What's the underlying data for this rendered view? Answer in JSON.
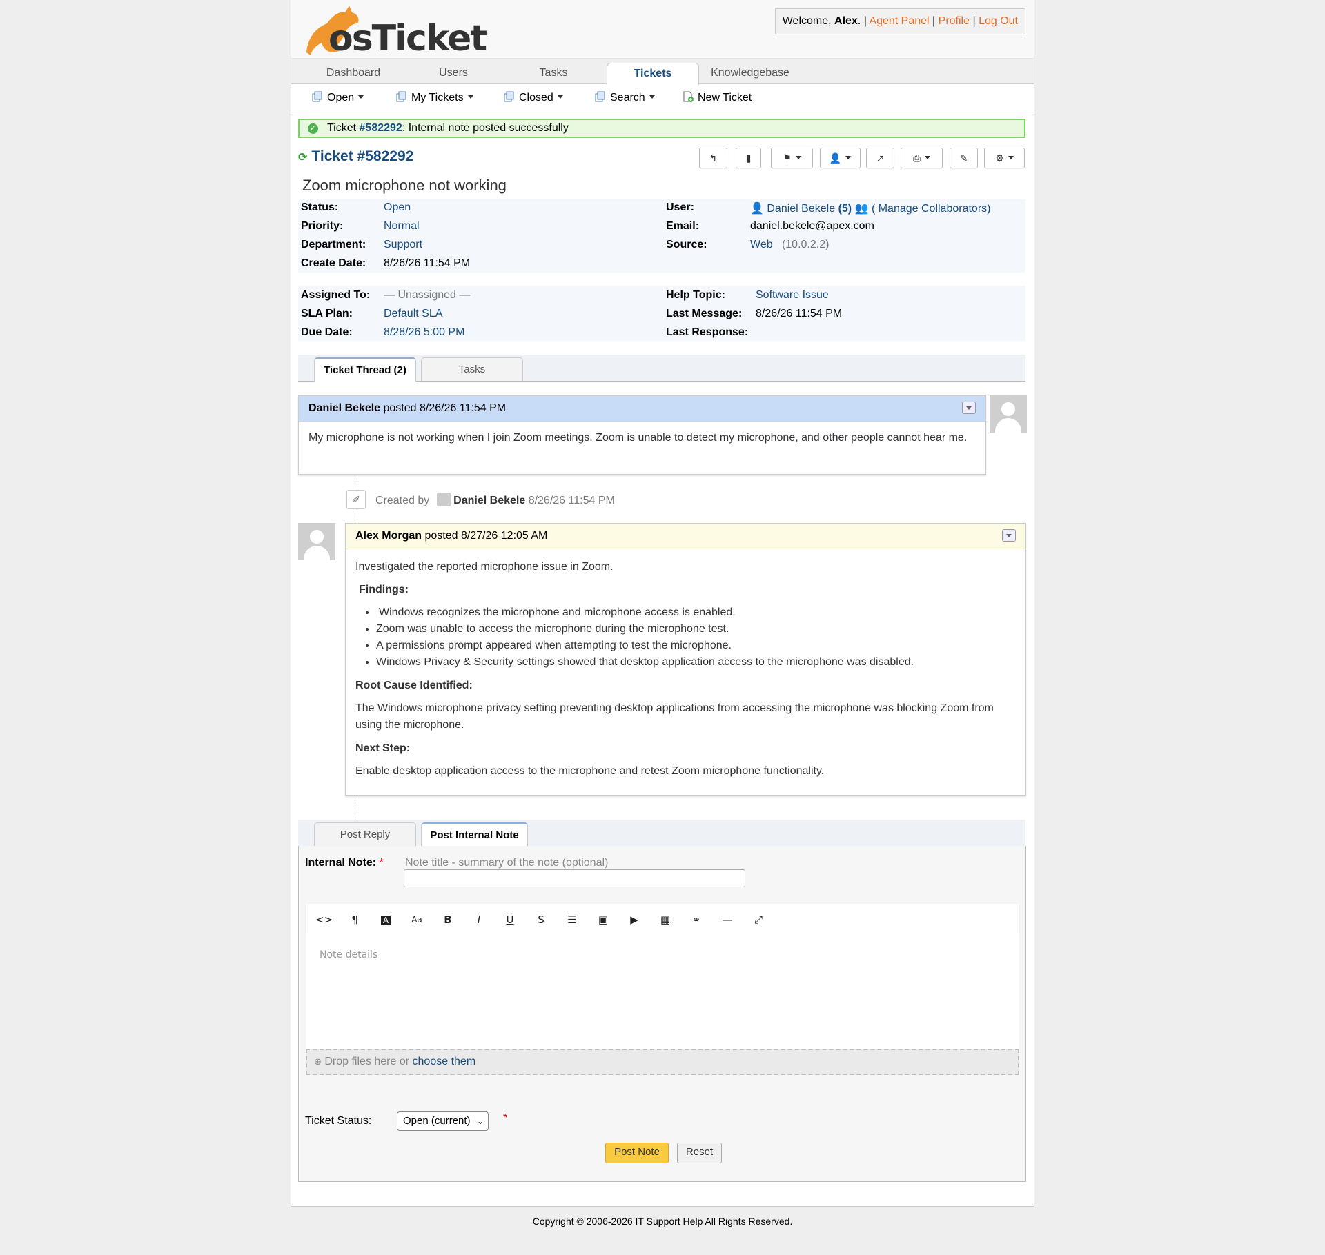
{
  "header": {
    "logo_text": "osTicket",
    "welcome_prefix": "Welcome, ",
    "user_name": "Alex",
    "welcome_suffix": ". | ",
    "agent_panel": "Agent Panel",
    "sep1": " | ",
    "profile": "Profile",
    "sep2": " | ",
    "logout": "Log Out"
  },
  "nav": {
    "tabs": [
      {
        "label": "Dashboard"
      },
      {
        "label": "Users"
      },
      {
        "label": "Tasks"
      },
      {
        "label": "Tickets"
      },
      {
        "label": "Knowledgebase"
      }
    ],
    "active": "Tickets"
  },
  "subnav": {
    "open": "Open",
    "my_tickets": "My Tickets",
    "closed": "Closed",
    "search": "Search",
    "new_ticket": "New Ticket"
  },
  "message": {
    "prefix": "Ticket ",
    "ticket_link": "#582292",
    "text": ": Internal note posted successfully"
  },
  "ticket": {
    "title": "Ticket #582292",
    "subject": "Zoom microphone not working",
    "labels": {
      "status": "Status:",
      "priority": "Priority:",
      "department": "Department:",
      "create_date": "Create Date:",
      "user": "User:",
      "email": "Email:",
      "source": "Source:",
      "assigned_to": "Assigned To:",
      "sla_plan": "SLA Plan:",
      "due_date": "Due Date:",
      "help_topic": "Help Topic:",
      "last_message": "Last Message:",
      "last_response": "Last Response:"
    },
    "status": "Open",
    "priority": "Normal",
    "department": "Support",
    "create_date": "8/26/26 11:54 PM",
    "user_name": "Daniel Bekele",
    "user_count": "(5)",
    "manage_collaborators": "( Manage Collaborators)",
    "email": "daniel.bekele@apex.com",
    "source": "Web",
    "source_ip": "(10.0.2.2)",
    "assigned_to": "— Unassigned —",
    "sla_plan": "Default SLA",
    "due_date": "8/28/26 5:00 PM",
    "help_topic": "Software Issue",
    "last_message": "8/26/26 11:54 PM",
    "last_response": ""
  },
  "thread_tabs": {
    "thread": "Ticket Thread (2)",
    "tasks": "Tasks"
  },
  "entries": {
    "first": {
      "author": "Daniel Bekele",
      "posted": " posted 8/26/26 11:54 PM",
      "body": "My microphone is not working when I join Zoom meetings. Zoom is unable to detect my microphone, and other people cannot hear me."
    },
    "event": {
      "created_by": "Created by",
      "author": "Daniel Bekele",
      "time": "8/26/26 11:54 PM"
    },
    "second": {
      "author": "Alex Morgan",
      "posted": " posted 8/27/26 12:05 AM",
      "intro": "Investigated the reported microphone issue in Zoom.",
      "findings_heading": "Findings:",
      "findings": [
        "Windows recognizes the microphone and microphone access is enabled.",
        "Zoom was unable to access the microphone during the microphone test.",
        "A permissions prompt appeared when attempting to test the microphone.",
        "Windows Privacy & Security settings showed that desktop application access to the microphone was disabled."
      ],
      "root_heading": "Root Cause Identified:",
      "root_text": "The Windows microphone privacy setting preventing desktop applications from accessing the microphone was blocking Zoom from using the microphone.",
      "next_heading": "Next Step:",
      "next_text": "Enable desktop application access to the microphone and retest Zoom microphone functionality."
    }
  },
  "response": {
    "tab_reply": "Post Reply",
    "tab_note": "Post Internal Note",
    "note_label": "Internal Note:",
    "required": "*",
    "note_title_hint": "Note title - summary of the note (optional)",
    "note_details_placeholder": "Note details",
    "drop_text": "Drop files here or ",
    "choose_them": "choose them",
    "status_label": "Ticket Status:",
    "status_value": "Open (current)",
    "post_note": "Post Note",
    "reset": "Reset"
  },
  "footer": {
    "copyright": "Copyright © 2006-2026 IT Support Help All Rights Reserved."
  },
  "colors": {
    "link": "#184e81",
    "header_orange": "#e06e2e",
    "success_border": "#7cd35f",
    "user_entry_header": "#c8dcf8",
    "agent_entry_header": "#fdfbe3",
    "post_note_button": "#f9c940"
  }
}
